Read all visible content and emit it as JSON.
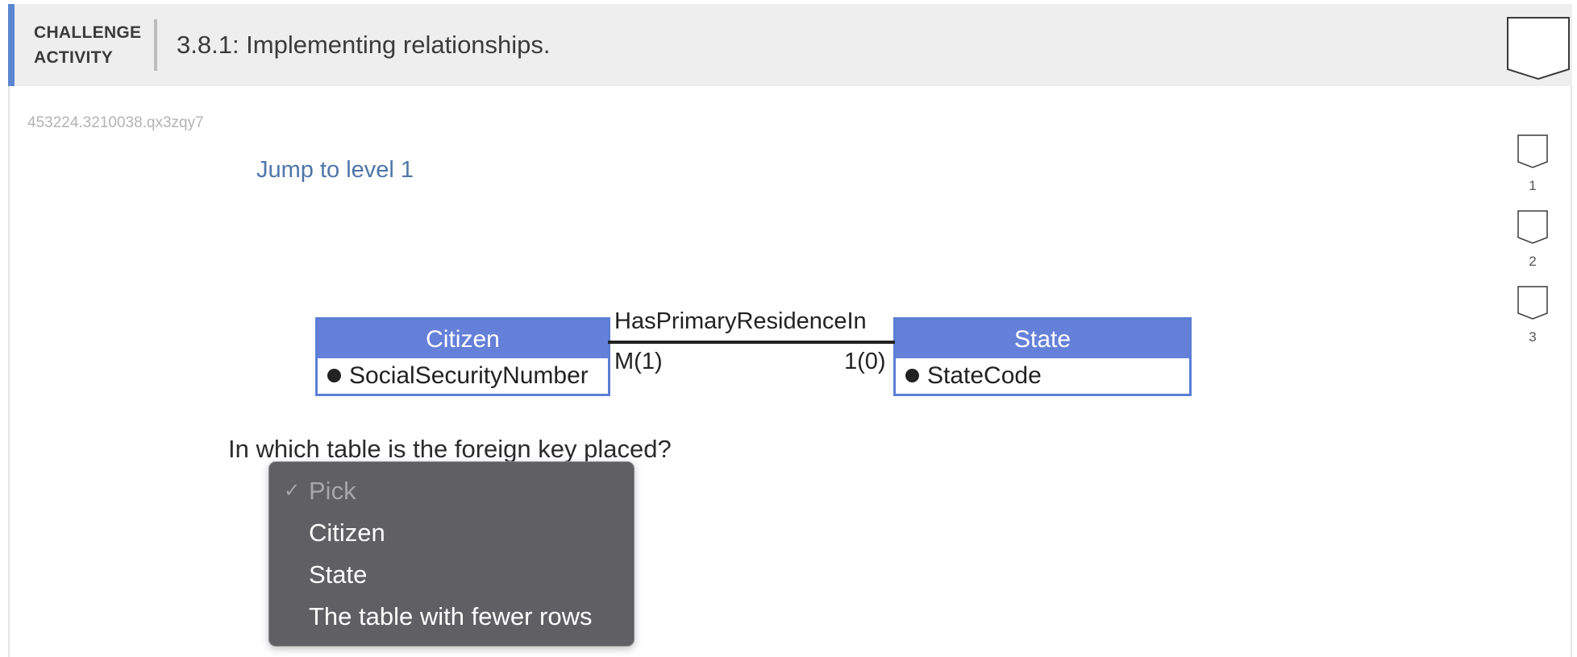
{
  "header": {
    "label_line1": "CHALLENGE",
    "label_line2": "ACTIVITY",
    "title": "3.8.1: Implementing relationships."
  },
  "activity_id": "453224.3210038.qx3zqy7",
  "jump_link": "Jump to level 1",
  "levels": [
    "1",
    "2",
    "3"
  ],
  "diagram": {
    "left_entity": {
      "name": "Citizen",
      "attribute": "SocialSecurityNumber"
    },
    "right_entity": {
      "name": "State",
      "attribute": "StateCode"
    },
    "relationship": "HasPrimaryResidenceIn",
    "left_cardinality": "M(1)",
    "right_cardinality": "1(0)"
  },
  "question": "In which table is the foreign key placed?",
  "dropdown": {
    "selected": "Pick",
    "checkmark": "✓",
    "options": [
      "Pick",
      "Citizen",
      "State",
      "The table with fewer rows"
    ]
  },
  "colors": {
    "accent": "#5b86d0",
    "entity_header": "#6580d8",
    "entity_border": "#5b7fd6",
    "link": "#4f76a8",
    "menu_background": "#606064"
  }
}
